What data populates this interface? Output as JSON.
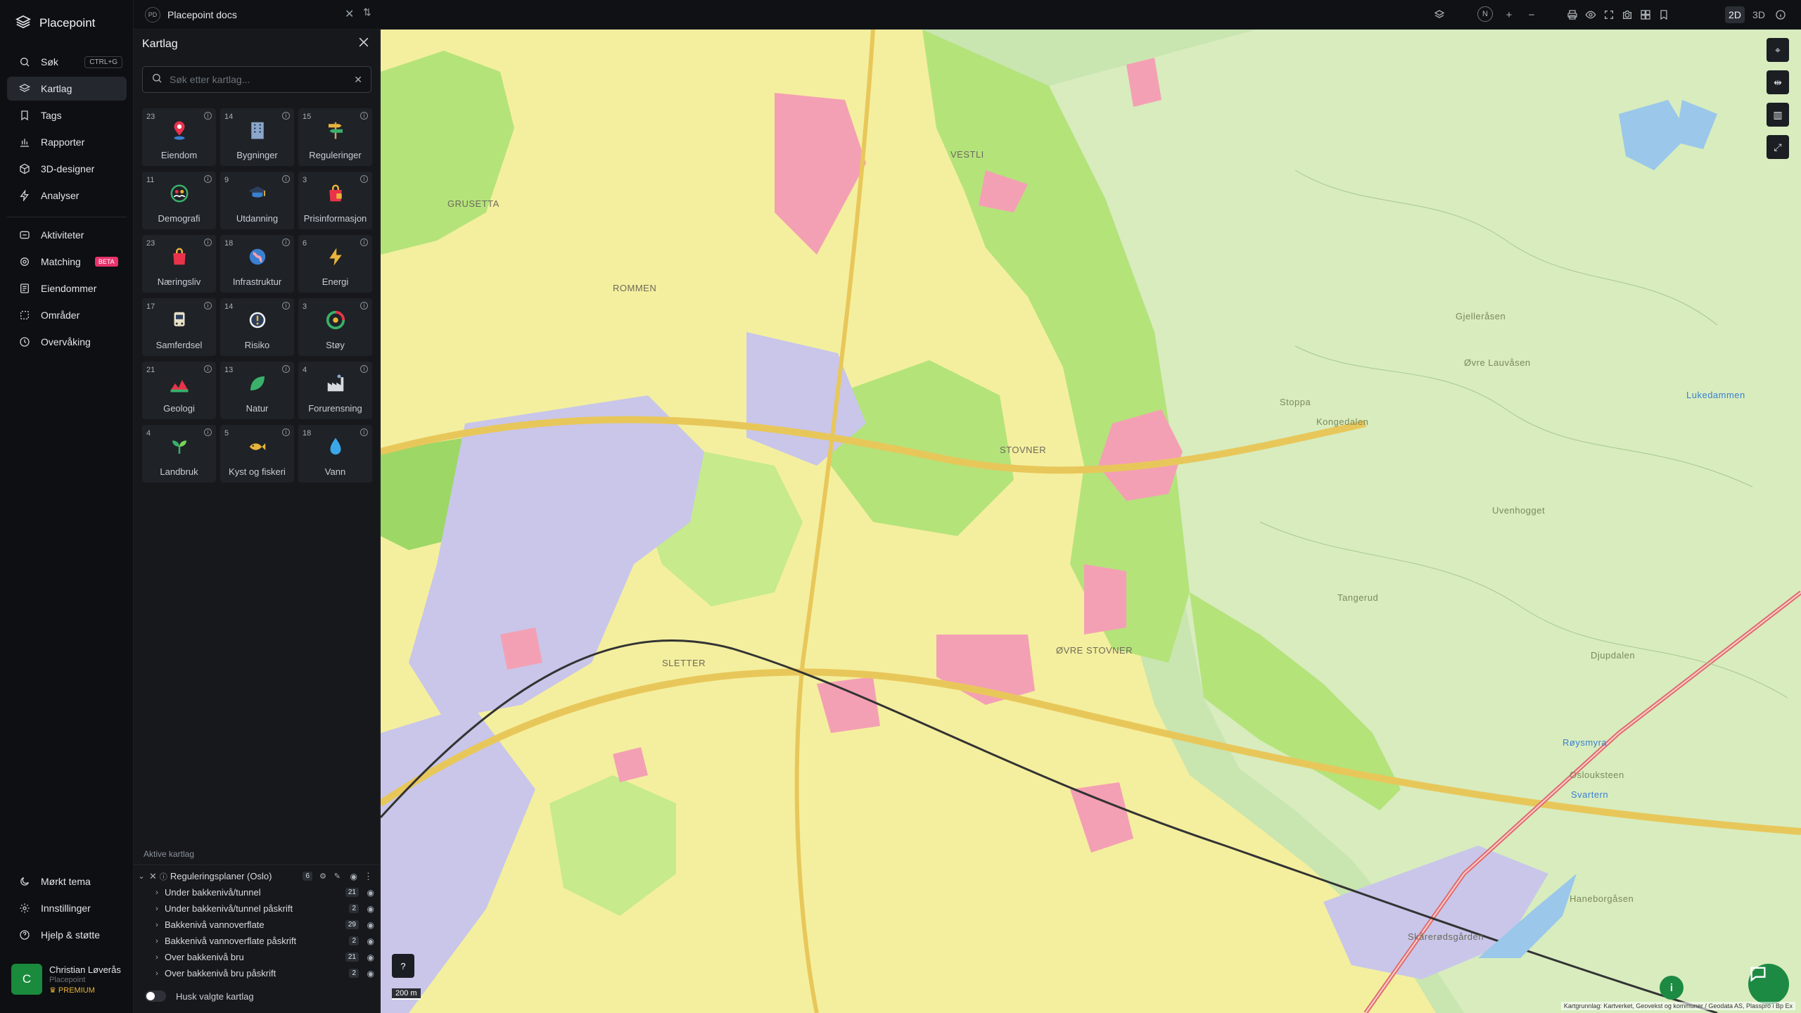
{
  "brand": {
    "name": "Placepoint"
  },
  "nav": {
    "items": [
      {
        "label": "Søk",
        "shortcut": "CTRL+G"
      },
      {
        "label": "Kartlag"
      },
      {
        "label": "Tags"
      },
      {
        "label": "Rapporter"
      },
      {
        "label": "3D-designer"
      },
      {
        "label": "Analyser"
      }
    ],
    "items2": [
      {
        "label": "Aktiviteter"
      },
      {
        "label": "Matching",
        "badge": "BETA"
      },
      {
        "label": "Eiendommer"
      },
      {
        "label": "Områder"
      },
      {
        "label": "Overvåking"
      }
    ],
    "bottom": [
      {
        "label": "Mørkt tema"
      },
      {
        "label": "Innstillinger"
      },
      {
        "label": "Hjelp & støtte"
      }
    ]
  },
  "user": {
    "initial": "C",
    "name": "Christian Løverås",
    "org": "Placepoint",
    "tier": "PREMIUM"
  },
  "workspace": {
    "badge": "PD",
    "name": "Placepoint docs"
  },
  "toolbar": {
    "north": "N",
    "plus": "+",
    "minus": "−",
    "mode_2d": "2D",
    "mode_3d": "3D"
  },
  "panel": {
    "title": "Kartlag",
    "search_placeholder": "Søk etter kartlag...",
    "categories": [
      {
        "count": "23",
        "label": "Eiendom",
        "icon": "pin-icon"
      },
      {
        "count": "14",
        "label": "Bygninger",
        "icon": "building-icon"
      },
      {
        "count": "15",
        "label": "Reguleringer",
        "icon": "signpost-icon"
      },
      {
        "count": "11",
        "label": "Demografi",
        "icon": "people-icon"
      },
      {
        "count": "9",
        "label": "Utdanning",
        "icon": "graduation-icon"
      },
      {
        "count": "3",
        "label": "Prisinformasjon",
        "icon": "price-bag-icon"
      },
      {
        "count": "23",
        "label": "Næringsliv",
        "icon": "shopping-bag-icon"
      },
      {
        "count": "18",
        "label": "Infrastruktur",
        "icon": "globe-icon"
      },
      {
        "count": "6",
        "label": "Energi",
        "icon": "lightning-icon"
      },
      {
        "count": "17",
        "label": "Samferdsel",
        "icon": "bus-icon"
      },
      {
        "count": "14",
        "label": "Risiko",
        "icon": "hazard-icon"
      },
      {
        "count": "3",
        "label": "Støy",
        "icon": "noise-gauge-icon"
      },
      {
        "count": "21",
        "label": "Geologi",
        "icon": "terrain-icon"
      },
      {
        "count": "13",
        "label": "Natur",
        "icon": "leaf-icon"
      },
      {
        "count": "4",
        "label": "Forurensning",
        "icon": "factory-icon"
      },
      {
        "count": "4",
        "label": "Landbruk",
        "icon": "sprout-icon"
      },
      {
        "count": "5",
        "label": "Kyst og fiskeri",
        "icon": "fish-icon"
      },
      {
        "count": "18",
        "label": "Vann",
        "icon": "water-drop-icon"
      }
    ],
    "active_title": "Aktive kartlag",
    "active_group": {
      "label": "Reguleringsplaner (Oslo)",
      "count": "6"
    },
    "active_layers": [
      {
        "label": "Under bakkenivå/tunnel",
        "count": "21"
      },
      {
        "label": "Under bakkenivå/tunnel påskrift",
        "count": "2"
      },
      {
        "label": "Bakkenivå vannoverflate",
        "count": "29"
      },
      {
        "label": "Bakkenivå vannoverflate påskrift",
        "count": "2"
      },
      {
        "label": "Over bakkenivå bru",
        "count": "21"
      },
      {
        "label": "Over bakkenivå bru påskrift",
        "count": "2"
      }
    ],
    "remember_label": "Husk valgte kartlag"
  },
  "map": {
    "scale": "200 m",
    "attribution": "Kartgrunnlag: Kartverket, Geovekst og kommuner / Geodata AS, Plasspro i Bp Ex",
    "places": [
      "GRUSETTA",
      "VESTLI",
      "STOVNER",
      "ØVRE STOVNER",
      "SLETTER",
      "ROMMEN",
      "Gjelleråsen",
      "Øvre Lauvåsen",
      "Kongedalen",
      "Stoppa",
      "Uvenhogget",
      "Tangerud",
      "Djupdalen",
      "Oslouksteen",
      "Haneborgåsen",
      "Lukedammen",
      "Svartern",
      "Røysmyra",
      "Skårerødsgården"
    ]
  }
}
